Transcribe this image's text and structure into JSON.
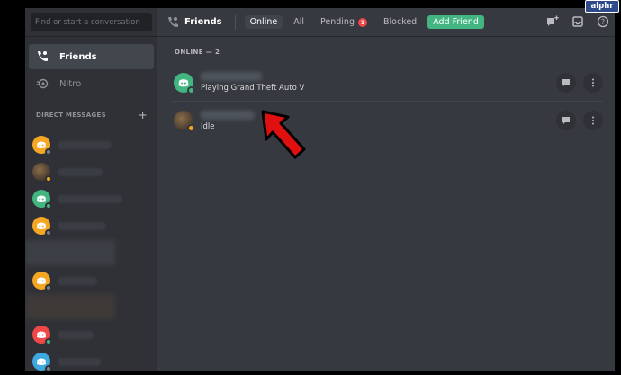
{
  "search": {
    "placeholder": "Find or start a conversation"
  },
  "sidebar": {
    "items": [
      {
        "label": "Friends",
        "icon": "friends-icon"
      },
      {
        "label": "Nitro",
        "icon": "nitro-icon"
      }
    ],
    "dm_header": "DIRECT MESSAGES",
    "dm_add": "+"
  },
  "topbar": {
    "title": "Friends",
    "tabs": [
      {
        "label": "Online"
      },
      {
        "label": "All"
      },
      {
        "label": "Pending"
      },
      {
        "label": "Blocked"
      }
    ],
    "pending_count": "1",
    "add_friend_label": "Add Friend"
  },
  "content": {
    "online_header": "ONLINE — 2",
    "friends": [
      {
        "activity": "Playing Grand Theft Auto V"
      },
      {
        "activity": "Idle"
      }
    ]
  },
  "watermark": "alphr",
  "colors": {
    "accent_green": "#43b581",
    "online": "#43b581",
    "idle": "#faa61a",
    "offline": "#747f8d",
    "badge_red": "#f04747",
    "arrow_red": "#e01010"
  }
}
